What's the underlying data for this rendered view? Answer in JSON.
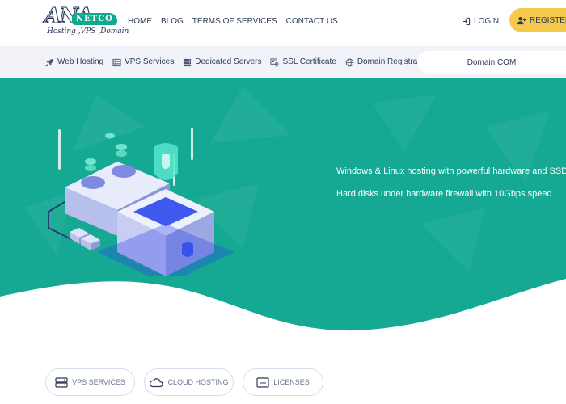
{
  "logo": {
    "wordmark": "ANA",
    "badge": "NETCO",
    "tagline": "Hosting ,VPS ,Domain"
  },
  "top_nav": {
    "items": [
      {
        "label": "HOME",
        "name": "nav-home"
      },
      {
        "label": "BLOG",
        "name": "nav-blog"
      },
      {
        "label": "TERMS OF SERVICES",
        "name": "nav-terms-of-services"
      },
      {
        "label": "CONTACT US",
        "name": "nav-contact-us"
      }
    ]
  },
  "auth": {
    "login_label": "LOGIN",
    "login_icon": "sign-in-icon",
    "register_label": "REGISTER",
    "register_icon": "add-user-icon"
  },
  "subnav": {
    "items": [
      {
        "label": "Web Hosting",
        "icon": "rocket-icon"
      },
      {
        "label": "VPS Services",
        "icon": "server-grid-icon"
      },
      {
        "label": "Dedicated Servers",
        "icon": "server-rack-icon"
      },
      {
        "label": "SSL Certificate",
        "icon": "certificate-icon"
      },
      {
        "label": "Domain Registration",
        "icon": "globe-icon"
      }
    ],
    "domain_label": "Domain.COM"
  },
  "hero": {
    "line1": "Windows & Linux hosting with powerful hardware and SSD",
    "line2": "Hard disks under hardware firewall with 10Gbps speed."
  },
  "service_tabs": [
    {
      "label": "VPS SERVICES",
      "icon": "vps-icon"
    },
    {
      "label": "CLOUD HOSTING",
      "icon": "cloud-icon"
    },
    {
      "label": "LICENSES",
      "icon": "license-icon"
    }
  ],
  "colors": {
    "hero_bg": "#15a993",
    "register_bg": "#f5c94c",
    "logo_badge": "#0fa98f",
    "subnav_bg": "#f1f3f9",
    "text_dark": "#2a3b57"
  }
}
